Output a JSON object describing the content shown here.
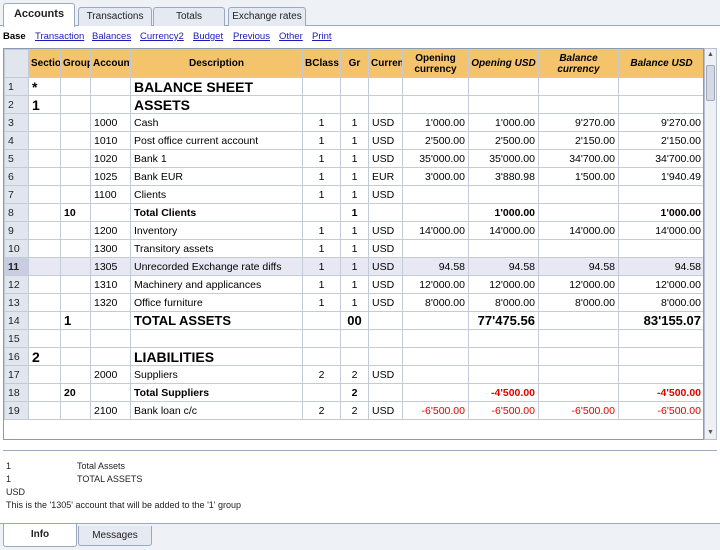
{
  "top_tabs": [
    "Accounts",
    "Transactions",
    "Totals",
    "Exchange rates"
  ],
  "view_links": [
    "Base",
    "Transaction",
    "Balances",
    "Currency2",
    "Budget",
    "Previous",
    "Other",
    "Print"
  ],
  "columns": {
    "section": "Section",
    "group": "Group",
    "account": "Account",
    "description": "Description",
    "bclass": "BClass",
    "gr": "Gr",
    "currency": "Currency",
    "opening_currency": "Opening currency",
    "opening_usd": "Opening USD",
    "balance_currency": "Balance currency",
    "balance_usd": "Balance USD"
  },
  "rows": [
    {
      "n": "1",
      "section": "*",
      "group": "",
      "account": "",
      "description": "BALANCE SHEET",
      "bclass": "",
      "gr": "",
      "currency": "",
      "oc": "",
      "ou": "",
      "bc": "",
      "bu": ""
    },
    {
      "n": "2",
      "section": "1",
      "group": "",
      "account": "",
      "description": "ASSETS",
      "bclass": "",
      "gr": "",
      "currency": "",
      "oc": "",
      "ou": "",
      "bc": "",
      "bu": ""
    },
    {
      "n": "3",
      "section": "",
      "group": "",
      "account": "1000",
      "description": "Cash",
      "bclass": "1",
      "gr": "1",
      "currency": "USD",
      "oc": "1'000.00",
      "ou": "1'000.00",
      "bc": "9'270.00",
      "bu": "9'270.00"
    },
    {
      "n": "4",
      "section": "",
      "group": "",
      "account": "1010",
      "description": "Post office current account",
      "bclass": "1",
      "gr": "1",
      "currency": "USD",
      "oc": "2'500.00",
      "ou": "2'500.00",
      "bc": "2'150.00",
      "bu": "2'150.00"
    },
    {
      "n": "5",
      "section": "",
      "group": "",
      "account": "1020",
      "description": "Bank 1",
      "bclass": "1",
      "gr": "1",
      "currency": "USD",
      "oc": "35'000.00",
      "ou": "35'000.00",
      "bc": "34'700.00",
      "bu": "34'700.00"
    },
    {
      "n": "6",
      "section": "",
      "group": "",
      "account": "1025",
      "description": "Bank EUR",
      "bclass": "1",
      "gr": "1",
      "currency": "EUR",
      "oc": "3'000.00",
      "ou": "3'880.98",
      "bc": "1'500.00",
      "bu": "1'940.49"
    },
    {
      "n": "7",
      "section": "",
      "group": "",
      "account": "1100",
      "description": "Clients",
      "bclass": "1",
      "gr": "1",
      "currency": "USD",
      "oc": "",
      "ou": "",
      "bc": "",
      "bu": ""
    },
    {
      "n": "8",
      "section": "",
      "group": "10",
      "account": "",
      "description": "Total Clients",
      "bclass": "",
      "gr": "1",
      "currency": "",
      "oc": "",
      "ou": "1'000.00",
      "bc": "",
      "bu": "1'000.00"
    },
    {
      "n": "9",
      "section": "",
      "group": "",
      "account": "1200",
      "description": "Inventory",
      "bclass": "1",
      "gr": "1",
      "currency": "USD",
      "oc": "14'000.00",
      "ou": "14'000.00",
      "bc": "14'000.00",
      "bu": "14'000.00"
    },
    {
      "n": "10",
      "section": "",
      "group": "",
      "account": "1300",
      "description": "Transitory assets",
      "bclass": "1",
      "gr": "1",
      "currency": "USD",
      "oc": "",
      "ou": "",
      "bc": "",
      "bu": ""
    },
    {
      "n": "11",
      "section": "",
      "group": "",
      "account": "1305",
      "description": "Unrecorded Exchange rate diffs",
      "bclass": "1",
      "gr": "1",
      "currency": "USD",
      "oc": "94.58",
      "ou": "94.58",
      "bc": "94.58",
      "bu": "94.58"
    },
    {
      "n": "12",
      "section": "",
      "group": "",
      "account": "1310",
      "description": "Machinery and applicances",
      "bclass": "1",
      "gr": "1",
      "currency": "USD",
      "oc": "12'000.00",
      "ou": "12'000.00",
      "bc": "12'000.00",
      "bu": "12'000.00"
    },
    {
      "n": "13",
      "section": "",
      "group": "",
      "account": "1320",
      "description": "Office furniture",
      "bclass": "1",
      "gr": "1",
      "currency": "USD",
      "oc": "8'000.00",
      "ou": "8'000.00",
      "bc": "8'000.00",
      "bu": "8'000.00"
    },
    {
      "n": "14",
      "section": "",
      "group": "1",
      "account": "",
      "description": "TOTAL ASSETS",
      "bclass": "",
      "gr": "00",
      "currency": "",
      "oc": "",
      "ou": "77'475.56",
      "bc": "",
      "bu": "83'155.07"
    },
    {
      "n": "15",
      "section": "",
      "group": "",
      "account": "",
      "description": "",
      "bclass": "",
      "gr": "",
      "currency": "",
      "oc": "",
      "ou": "",
      "bc": "",
      "bu": ""
    },
    {
      "n": "16",
      "section": "2",
      "group": "",
      "account": "",
      "description": "LIABILITIES",
      "bclass": "",
      "gr": "",
      "currency": "",
      "oc": "",
      "ou": "",
      "bc": "",
      "bu": ""
    },
    {
      "n": "17",
      "section": "",
      "group": "",
      "account": "2000",
      "description": "Suppliers",
      "bclass": "2",
      "gr": "2",
      "currency": "USD",
      "oc": "",
      "ou": "",
      "bc": "",
      "bu": ""
    },
    {
      "n": "18",
      "section": "",
      "group": "20",
      "account": "",
      "description": "Total Suppliers",
      "bclass": "",
      "gr": "2",
      "currency": "",
      "oc": "",
      "ou": "-4'500.00",
      "bc": "",
      "bu": "-4'500.00"
    },
    {
      "n": "19",
      "section": "",
      "group": "",
      "account": "2100",
      "description": "Bank loan c/c",
      "bclass": "2",
      "gr": "2",
      "currency": "USD",
      "oc": "-6'500.00",
      "ou": "-6'500.00",
      "bc": "-6'500.00",
      "bu": "-6'500.00"
    }
  ],
  "info_lines": [
    "1",
    "Total Assets",
    "1",
    "TOTAL ASSETS",
    "USD",
    "This is the '1305' account that will be added to the '1' group"
  ],
  "bottom_tabs": [
    "Info",
    "Messages"
  ],
  "colors": {
    "header": "#f5c36b",
    "negative": "#e00000",
    "link": "#1a1ab8"
  }
}
